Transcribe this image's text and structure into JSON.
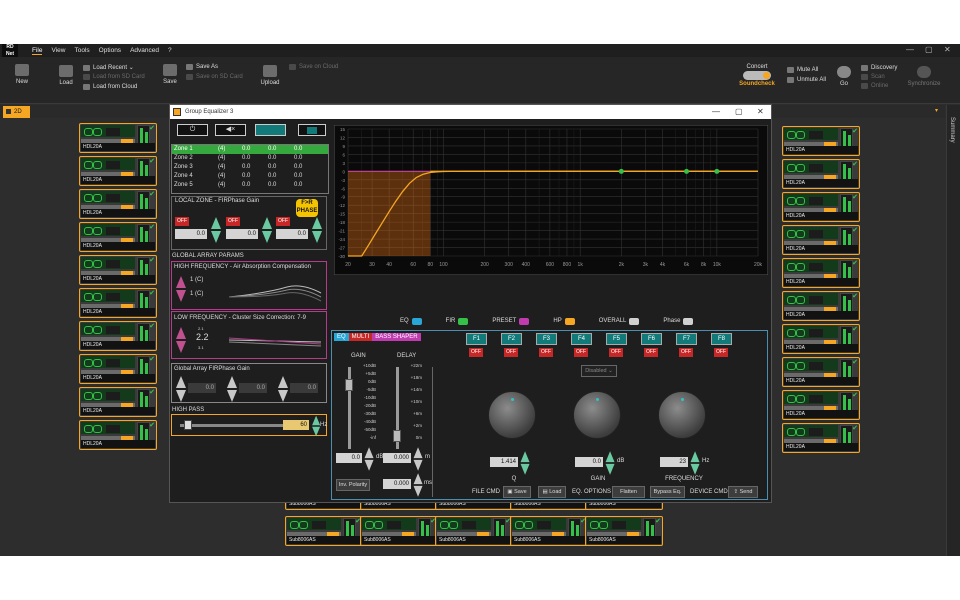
{
  "menubar": {
    "logo": "RD\nNet",
    "items": [
      "File",
      "View",
      "Tools",
      "Options",
      "Advanced",
      "?"
    ]
  },
  "ribbon": {
    "new": "New",
    "load": "Load",
    "load_recent": "Load Recent",
    "load_sd": "Load from SD Card",
    "load_cloud": "Load from Cloud",
    "save": "Save",
    "save_as": "Save As",
    "save_sd": "Save on SD Card",
    "upload": "Upload",
    "save_cloud": "Save on Cloud",
    "mode_top": "Concert",
    "mode_bottom": "Soundcheck",
    "mute_all": "Mute All",
    "unmute_all": "Unmute All",
    "go": "Go",
    "discovery": "Discovery",
    "scan": "Scan",
    "online": "Online",
    "synchronize": "Synchronize"
  },
  "tabs": {
    "active": "2D",
    "side_panel": "Summary"
  },
  "devices": {
    "left_label": "HDL20A",
    "right_label": "HDL20A",
    "bottom_label": "Sub8006AS",
    "left_count": 10,
    "right_count": 10,
    "bottom_count": 10
  },
  "eq": {
    "title": "Group Equalizer 3",
    "zones": [
      {
        "name": "Zone 1",
        "count": "(4)",
        "a": "0.0",
        "b": "0.0",
        "c": "0.0"
      },
      {
        "name": "Zone 2",
        "count": "(4)",
        "a": "0.0",
        "b": "0.0",
        "c": "0.0"
      },
      {
        "name": "Zone 3",
        "count": "(4)",
        "a": "0.0",
        "b": "0.0",
        "c": "0.0"
      },
      {
        "name": "Zone 4",
        "count": "(4)",
        "a": "0.0",
        "b": "0.0",
        "c": "0.0"
      },
      {
        "name": "Zone 5",
        "count": "(4)",
        "a": "0.0",
        "b": "0.0",
        "c": "0.0"
      }
    ],
    "local_zone_title": "LOCAL ZONE - FIRPhase Gain",
    "fir_logo": "F>R PHASE",
    "local_zone": [
      {
        "off": "OFF",
        "value": "0.0"
      },
      {
        "off": "OFF",
        "value": "0.0"
      },
      {
        "off": "OFF",
        "value": "0.0"
      }
    ],
    "global_title": "GLOBAL ARRAY PARAMS",
    "hf_title": "HIGH FREQUENCY - Air Absorption Compensation",
    "hf_values": [
      "1 (C)",
      "1 (C)"
    ],
    "lf_title": "LOW FREQUENCY - Cluster Size Correction: 7-9",
    "lf_value": "2.2",
    "lf_top": "2.1",
    "lf_bottom": "3.1",
    "gafir_title": "Global Array FIRPhase Gain",
    "gafir": [
      "0.0",
      "0.0",
      "0.0"
    ],
    "highpass_title": "HIGH PASS",
    "highpass_value": "60",
    "highpass_unit": "Hz",
    "x_ticks": [
      "20",
      "30",
      "40",
      "60",
      "80",
      "100",
      "200",
      "300",
      "400",
      "600",
      "800",
      "1k",
      "2k",
      "3k",
      "4k",
      "6k",
      "8k",
      "10k",
      "20k"
    ],
    "y_ticks": [
      "15",
      "12",
      "9",
      "6",
      "3",
      "0",
      "-3",
      "-6",
      "-9",
      "-12",
      "-15",
      "-18",
      "-21",
      "-24",
      "-27",
      "-30"
    ],
    "toggles": [
      "EQ",
      "FIR",
      "PRESET",
      "HP",
      "OVERALL",
      "Phase"
    ],
    "mode_tabs": [
      "EQ",
      "MULTI",
      "BASS SHAPER"
    ],
    "gain_label": "GAIN",
    "delay_label": "DELAY",
    "gain_scale": [
      "+10dB",
      "+5dB",
      "0dB",
      "-5dB",
      "-10dB",
      "-20dB",
      "-30dB",
      "-40dB",
      "-50dB",
      "-inf"
    ],
    "delay_scale": [
      "+22m",
      "+18m",
      "+14m",
      "+10m",
      "+6m",
      "+2m",
      "0m"
    ],
    "gain_value": "0.0",
    "gain_unit": "dB",
    "delay_value": "0.000",
    "delay_unit": "m",
    "polarity": "Inv. Polarity",
    "ms_value": "0.000",
    "ms_unit": "ms",
    "filters": [
      "F1",
      "F2",
      "F3",
      "F4",
      "F5",
      "F6",
      "F7",
      "F8"
    ],
    "filter_state": "OFF",
    "disabled": "Disabled",
    "q_value": "1.414",
    "q_label": "Q",
    "knob_gain_value": "0.0",
    "knob_gain_unit": "dB",
    "knob_gain_label": "GAIN",
    "freq_value": "23",
    "freq_unit": "Hz",
    "freq_label": "FREQUENCY",
    "file_cmd": "FILE CMD",
    "save": "Save",
    "load": "Load",
    "eq_options": "EQ. OPTIONS",
    "flatten": "Flatten",
    "bypass": "Bypass Eq.",
    "device_cmd": "DEVICE CMD",
    "send": "Send"
  },
  "colors": {
    "accent": "#f5a623",
    "green": "#35c04a",
    "teal": "#137a7a",
    "magenta": "#b43c8c",
    "curve": "#f5a623"
  }
}
